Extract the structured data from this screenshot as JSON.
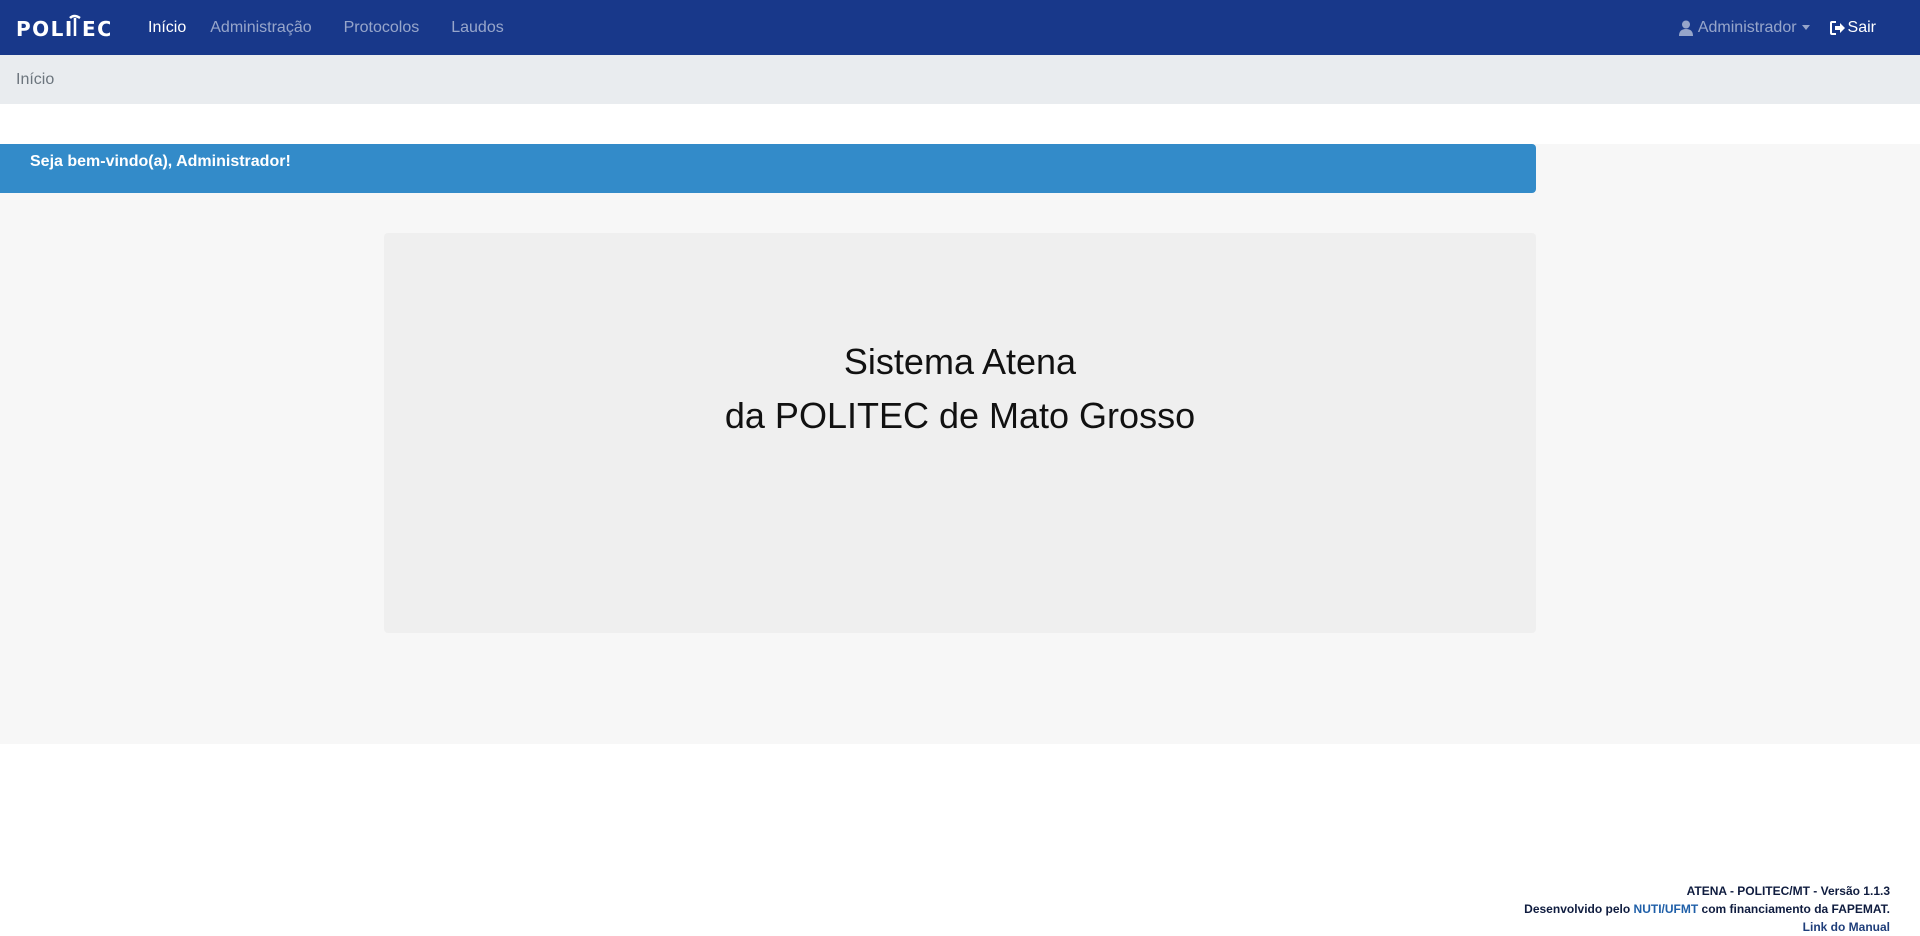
{
  "navbar": {
    "brand": "POLITEC",
    "links": [
      {
        "label": "Início",
        "active": true
      },
      {
        "label": "Administração",
        "active": false
      },
      {
        "label": "Protocolos",
        "active": false
      },
      {
        "label": "Laudos",
        "active": false
      }
    ],
    "user_label": "Administrador",
    "user_icon": "user-icon",
    "logout_label": "Sair",
    "logout_icon": "sign-out-icon"
  },
  "breadcrumb": {
    "items": [
      "Início"
    ]
  },
  "welcome": {
    "message": "Seja bem-vindo(a), Administrador!"
  },
  "hero": {
    "line1": "Sistema Atena",
    "line2": "da POLITEC de Mato Grosso"
  },
  "footer": {
    "version": "ATENA - POLITEC/MT - Versão 1.1.3",
    "dev_prefix": "Desenvolvido pelo ",
    "dev_link": "NUTI/UFMT",
    "dev_suffix": " com financiamento da FAPEMAT.",
    "manual_link": "Link do Manual"
  },
  "colors": {
    "navbar": "#18388a",
    "breadcrumb_bg": "#e9ecef",
    "welcome_bg": "#338bc9",
    "hero_bg": "#efefef"
  }
}
